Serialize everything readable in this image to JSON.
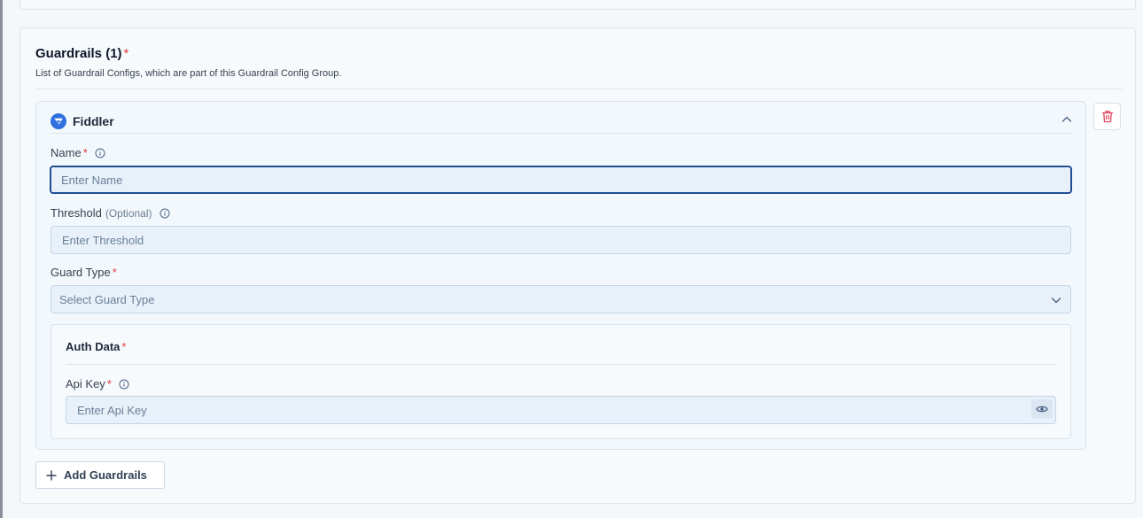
{
  "section": {
    "title": "Guardrails (1)",
    "required_mark": "*",
    "description": "List of Guardrail Configs, which are part of this Guardrail Config Group."
  },
  "guardrail": {
    "name": "Fiddler",
    "logo_icon": "fiddler-logo-icon",
    "fields": {
      "name": {
        "label": "Name",
        "required_mark": "*",
        "placeholder": "Enter Name",
        "value": ""
      },
      "threshold": {
        "label": "Threshold",
        "optional_text": "(Optional)",
        "placeholder": "Enter Threshold",
        "value": ""
      },
      "guard_type": {
        "label": "Guard Type",
        "required_mark": "*",
        "placeholder": "Select Guard Type"
      }
    },
    "auth_data": {
      "title": "Auth Data",
      "required_mark": "*",
      "api_key": {
        "label": "Api Key",
        "required_mark": "*",
        "placeholder": "Enter Api Key",
        "value": ""
      }
    }
  },
  "actions": {
    "add_label": "Add Guardrails"
  },
  "colors": {
    "accent": "#1f4f8f",
    "required": "#e03b3b",
    "delete": "#e0475b",
    "logo": "#2f6fe0"
  }
}
